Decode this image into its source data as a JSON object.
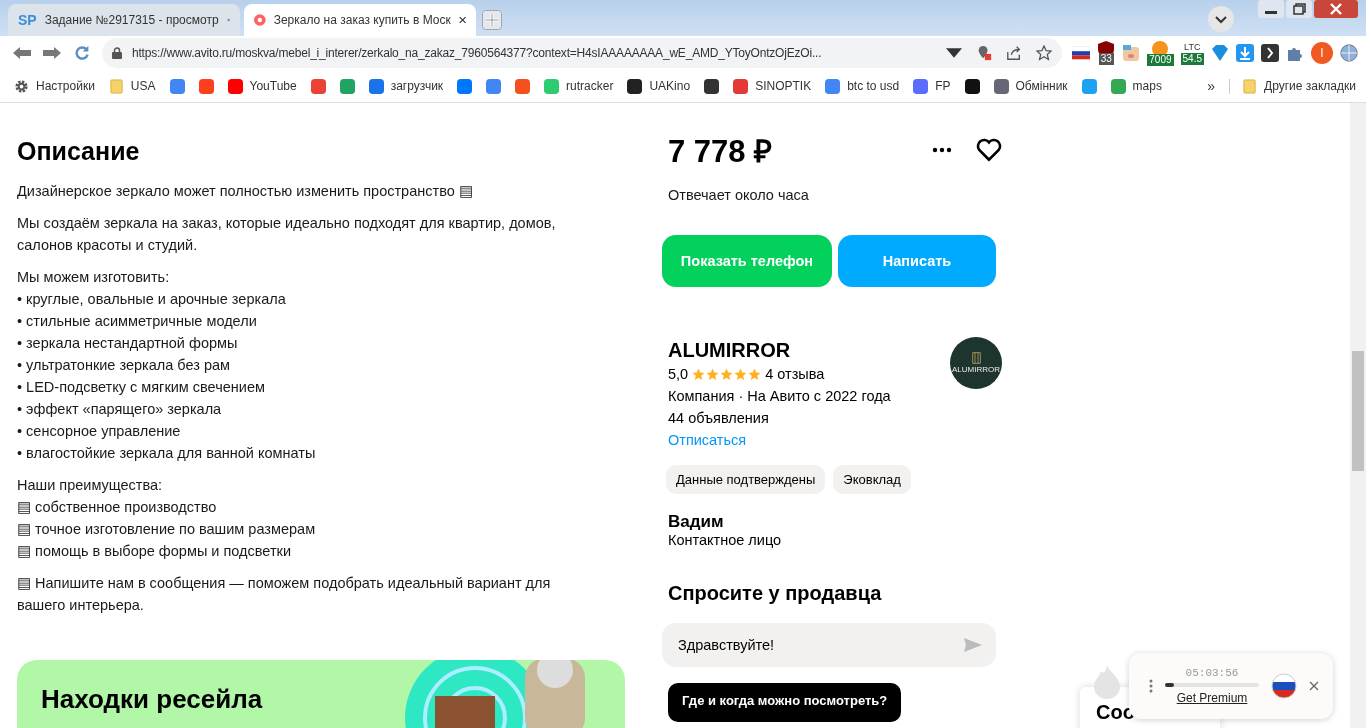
{
  "browser": {
    "tabs": [
      {
        "title": "Задание №2917315 - просмотр",
        "favicon": "SP",
        "selected": false
      },
      {
        "title": "Зеркало на заказ купить в Моск",
        "selected": true
      }
    ],
    "url": "https://www.avito.ru/moskva/mebel_i_interer/zerkalo_na_zakaz_7960564377?context=H4sIAAAAAAAA_wE_AMD_YToyOntzOjEzOi...",
    "extensions": [
      {
        "badge": "33"
      },
      {
        "badge": "7009"
      },
      {
        "label": "LTC",
        "badge": "54.5"
      }
    ],
    "profile_initial": "I",
    "bookmarks": [
      {
        "kind": "labeled",
        "label": "Настройки"
      },
      {
        "kind": "labeled",
        "label": "USA"
      },
      {
        "kind": "icon"
      },
      {
        "kind": "icon"
      },
      {
        "kind": "labeled",
        "label": "YouTube"
      },
      {
        "kind": "icon"
      },
      {
        "kind": "icon"
      },
      {
        "kind": "labeled",
        "label": "загрузчик"
      },
      {
        "kind": "icon"
      },
      {
        "kind": "icon"
      },
      {
        "kind": "icon"
      },
      {
        "kind": "labeled",
        "label": "rutracker"
      },
      {
        "kind": "labeled",
        "label": "UAKino"
      },
      {
        "kind": "icon"
      },
      {
        "kind": "labeled",
        "label": "SINOPTIK"
      },
      {
        "kind": "labeled",
        "label": "btc to usd"
      },
      {
        "kind": "labeled",
        "label": "FP"
      },
      {
        "kind": "icon"
      },
      {
        "kind": "labeled",
        "label": "Обмінник"
      },
      {
        "kind": "icon"
      },
      {
        "kind": "labeled",
        "label": "maps"
      }
    ],
    "overflow": "»",
    "other_bookmarks": "Другие закладки"
  },
  "description": {
    "heading": "Описание",
    "blocks": [
      {
        "kind": "text",
        "text": "Дизайнерское зеркало может полностью изменить пространство ▤"
      },
      {
        "kind": "text",
        "text": "Мы создаём зеркала на заказ, которые идеально подходят для квартир, домов, салонов красоты и студий."
      },
      {
        "kind": "lines",
        "lines": [
          "Мы можем изготовить:",
          "• круглые, овальные и арочные зеркала",
          "• стильные асимметричные модели",
          "• зеркала нестандартной формы",
          "• ультратонкие зеркала без рам",
          "• LED-подсветку с мягким свечением",
          "• эффект «парящего» зеркала",
          "• сенсорное управление",
          "• влагостойкие зеркала для ванной комнаты"
        ]
      },
      {
        "kind": "lines",
        "lines": [
          "Наши преимущества:",
          "▤ собственное производство",
          "▤ точное изготовление по вашим размерам",
          "▤ помощь в выборе формы и подсветки"
        ]
      },
      {
        "kind": "text",
        "text": "▤ Напишите нам в сообщения — поможем подобрать идеальный вариант для вашего интерьера."
      }
    ]
  },
  "promo": {
    "title": "Находки ресейла"
  },
  "listing": {
    "price": "7 778 ₽",
    "response_time": "Отвечает около часа",
    "buttons": [
      {
        "label": "Показать телефон",
        "kind": "phone"
      },
      {
        "label": "Написать",
        "kind": "message"
      }
    ]
  },
  "seller": {
    "name": "ALUMIRROR",
    "logo_text": "ALUMIRROR",
    "rating": "5,0",
    "stars": 5,
    "reviews": "4 отзыва",
    "info": "Компания · На Авито с 2022 года",
    "ads": "44 объявления",
    "unsubscribe": "Отписаться",
    "tags": [
      "Данные подтверждены",
      "Эковклад"
    ],
    "contact_name": "Вадим",
    "contact_role": "Контактное лицо"
  },
  "ask": {
    "heading": "Спросите у продавца",
    "message": "Здравствуйте!",
    "suggestions": [
      "Где и когда можно посмотреть?"
    ]
  },
  "chat_widget": {
    "title": "Coo"
  },
  "vpn_widget": {
    "timer": "05:03:56",
    "level": 0.1,
    "link": "Get Premium"
  }
}
